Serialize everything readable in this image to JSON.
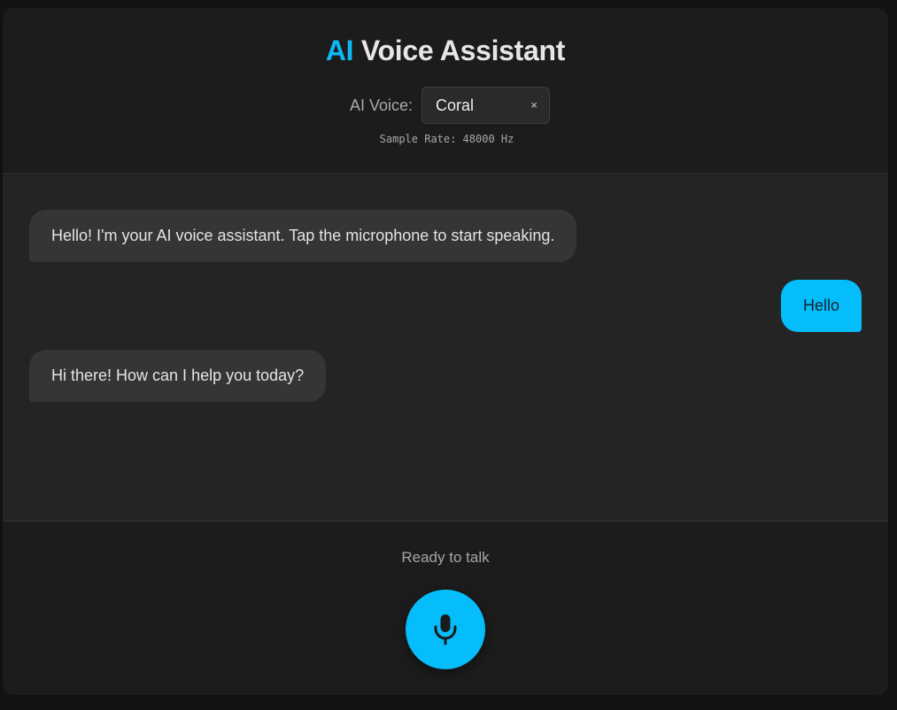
{
  "header": {
    "title_accent": "AI",
    "title_rest": " Voice Assistant",
    "voice_label": "AI Voice:",
    "voice_value": "Coral",
    "voice_clear": "×",
    "sample_rate": "Sample Rate: 48000 Hz"
  },
  "messages": [
    {
      "role": "assistant",
      "text": "Hello! I'm your AI voice assistant. Tap the microphone to start speaking."
    },
    {
      "role": "user",
      "text": "Hello"
    },
    {
      "role": "assistant",
      "text": "Hi there! How can I help you today?"
    }
  ],
  "footer": {
    "status": "Ready to talk",
    "mic_icon": "microphone-icon"
  },
  "colors": {
    "accent": "#06bdfc",
    "background": "#1c1c1c",
    "chat_background": "#242424",
    "assistant_bubble": "#353535"
  }
}
